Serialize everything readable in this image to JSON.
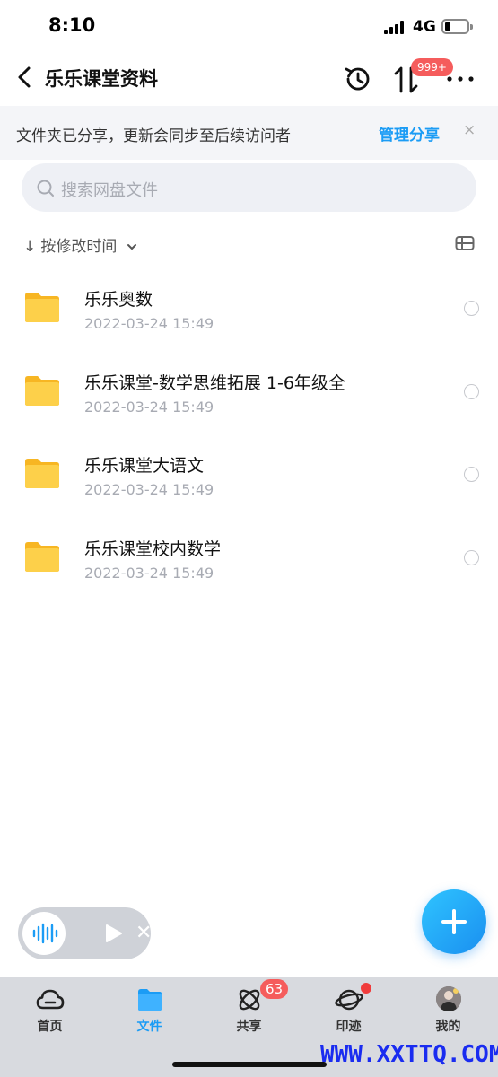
{
  "status": {
    "time": "8:10",
    "network": "4G"
  },
  "nav": {
    "title": "乐乐课堂资料",
    "transfer_badge": "999+"
  },
  "notice": {
    "message": "文件夹已分享，更新会同步至后续访问者",
    "action": "管理分享",
    "close": "×"
  },
  "search": {
    "placeholder": "搜索网盘文件"
  },
  "sort": {
    "arrow": "↓",
    "label": "按修改时间"
  },
  "files": [
    {
      "name": "乐乐奥数",
      "date": "2022-03-24 15:49"
    },
    {
      "name": "乐乐课堂-数学思维拓展 1-6年级全",
      "date": "2022-03-24 15:49"
    },
    {
      "name": "乐乐课堂大语文",
      "date": "2022-03-24 15:49"
    },
    {
      "name": "乐乐课堂校内数学",
      "date": "2022-03-24 15:49"
    }
  ],
  "audio": {
    "close": "✕"
  },
  "tabs": [
    {
      "label": "首页",
      "icon": "cloud-icon"
    },
    {
      "label": "文件",
      "icon": "folder-icon"
    },
    {
      "label": "共享",
      "icon": "atom-icon",
      "badge": "63"
    },
    {
      "label": "印迹",
      "icon": "planet-icon"
    },
    {
      "label": "我的",
      "icon": "avatar-icon"
    }
  ],
  "watermark": "WWW.XXTTQ.COM",
  "colors": {
    "accent": "#1b9cf5",
    "badge": "#f55c5c",
    "folder": "#fcc736"
  }
}
